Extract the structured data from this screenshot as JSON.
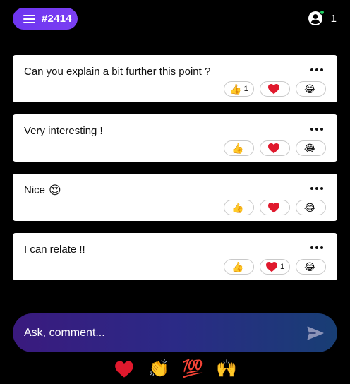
{
  "header": {
    "room_label": "#2414",
    "presence_count": "1"
  },
  "comments": [
    {
      "text": "Can you explain a bit further this point ?",
      "text_emoji": "",
      "reactions": {
        "thumbs_up": "1",
        "heart": "",
        "laugh": ""
      }
    },
    {
      "text": "Very interesting !",
      "text_emoji": "",
      "reactions": {
        "thumbs_up": "",
        "heart": "",
        "laugh": ""
      }
    },
    {
      "text": "Nice",
      "text_emoji": "😍",
      "reactions": {
        "thumbs_up": "",
        "heart": "",
        "laugh": ""
      }
    },
    {
      "text": "I can relate !!",
      "text_emoji": "",
      "reactions": {
        "thumbs_up": "",
        "heart": "1",
        "laugh": ""
      }
    }
  ],
  "composer": {
    "placeholder": "Ask, comment..."
  },
  "reaction_glyphs": {
    "thumbs_up": "👍",
    "laugh": "😂"
  },
  "quick_reactions": [
    "❤",
    "👏",
    "💯",
    "🙌"
  ],
  "colors": {
    "accent_purple": "#6d35f0",
    "heart_red": "#e0192d",
    "online_green": "#1fce62",
    "composer_start": "#3a1a7e",
    "composer_end": "#183e74"
  },
  "icons": {
    "room_menu": "menu-icon",
    "presence": "user-circle-icon",
    "more": "more-horizontal-icon",
    "send": "send-icon"
  }
}
